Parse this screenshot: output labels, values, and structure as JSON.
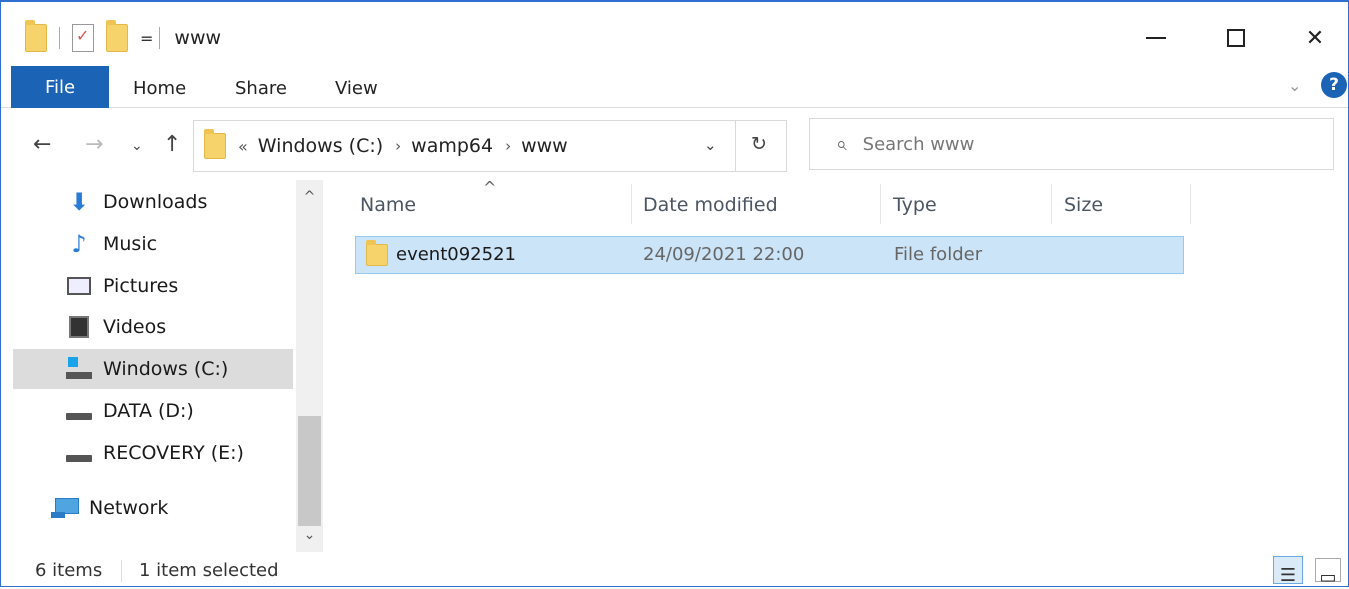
{
  "window": {
    "title": "www",
    "minimize_glyph": "",
    "close_glyph": "✕"
  },
  "qat": {
    "dropdown_glyph": "="
  },
  "ribbon": {
    "tabs": [
      "File",
      "Home",
      "Share",
      "View"
    ],
    "collapse_glyph": "⌄",
    "help_glyph": "?"
  },
  "nav": {
    "back_glyph": "←",
    "forward_glyph": "→",
    "recent_glyph": "⌄",
    "up_glyph": "↑",
    "address": {
      "lead": "«",
      "crumbs": [
        "Windows (C:)",
        "wamp64",
        "www"
      ],
      "separator": "›",
      "dropdown_glyph": "⌄",
      "refresh_glyph": "↻"
    },
    "search": {
      "icon_glyph": "⌕",
      "placeholder": "Search www"
    }
  },
  "sidebar": {
    "items": [
      {
        "label": "Downloads",
        "icon": "download-icon"
      },
      {
        "label": "Music",
        "icon": "music-icon"
      },
      {
        "label": "Pictures",
        "icon": "pictures-icon"
      },
      {
        "label": "Videos",
        "icon": "videos-icon"
      },
      {
        "label": "Windows (C:)",
        "icon": "windows-drive-icon",
        "selected": true
      },
      {
        "label": "DATA (D:)",
        "icon": "drive-icon"
      },
      {
        "label": "RECOVERY (E:)",
        "icon": "drive-icon"
      },
      {
        "label": "Network",
        "icon": "network-icon"
      }
    ],
    "scroll_up_glyph": "^",
    "scroll_down_glyph": "⌄",
    "icon_glyphs": {
      "download": "⬇",
      "music": "♪"
    }
  },
  "list": {
    "columns": [
      "Name",
      "Date modified",
      "Type",
      "Size"
    ],
    "sort_glyph": "^",
    "rows": [
      {
        "name": "event092521",
        "date": "24/09/2021 22:00",
        "type": "File folder",
        "size": ""
      }
    ]
  },
  "status": {
    "items": "6 items",
    "selected": "1 item selected",
    "details_glyph": "☰",
    "tiles_glyph": "▭"
  },
  "colors": {
    "accent": "#1b63b5",
    "selection": "#cce4f7",
    "selection_border": "#99c9ef",
    "sidebar_selected": "#dcdcdc"
  }
}
